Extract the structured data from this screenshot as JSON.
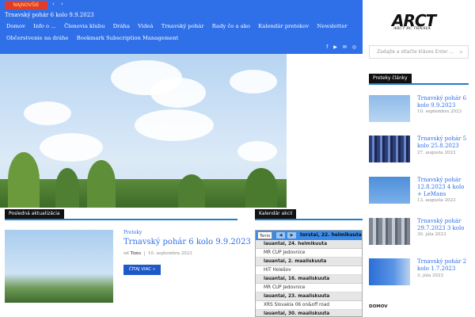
{
  "ticker": {
    "badge": "NAJNOVŠIE",
    "prev_icon": "‹",
    "next_icon": "›",
    "text": "Trnavský pohár 6 kolo 9.9.2023"
  },
  "nav": {
    "items": [
      "Domov",
      "Info o ...",
      "Členovia klubu",
      "Dráha",
      "Videá",
      "Trnavský pohár",
      "Rady čo a ako",
      "Kalendár pretekov",
      "Newsletter",
      "Občerstvenie na dráhe",
      "Bookmark Subscription Management"
    ]
  },
  "social": {
    "icons": [
      "f",
      "▶",
      "✉",
      "◎"
    ]
  },
  "sections": {
    "latest": "Posledná aktualizácia",
    "calendar": "Kalendár akcií"
  },
  "post": {
    "category": "Preteky",
    "title": "Trnavský pohár 6 kolo 9.9.2023",
    "by": "od",
    "author": "Tono",
    "separator": "|",
    "date": "10. septembra 2023",
    "read_more": "ČÍTAJ VIAC »"
  },
  "calendar": {
    "tab": "Tento&nbsp;",
    "tab_label": "Tento",
    "prev": "◀",
    "next": "▶",
    "current": "torstai, 22. helmikuuta",
    "days": [
      {
        "day": "lauantai, 24. helmikuuta",
        "event": "MR CUP Jedovnice"
      },
      {
        "day": "lauantai, 2. maaliskuuta",
        "event": "HIT Holešov"
      },
      {
        "day": "lauantai, 16. maaliskuuta",
        "event": "MR CUP Jedovnice"
      },
      {
        "day": "lauantai, 23. maaliskuuta",
        "event": "XRS Slovakia 06 on&off road"
      },
      {
        "day": "lauantai, 30. maaliskuuta",
        "event": ""
      }
    ]
  },
  "sidebar": {
    "logo": "ARCT",
    "logo_sub": "ARCT RC TRNAVA",
    "search_placeholder": "Zadajte a stlačte kláves Enter ...",
    "search_icon": "search-icon",
    "section": "Preteky články",
    "articles": [
      {
        "title": "Trnavský pohár 6 kolo 9.9.2023",
        "date": "10. septembra 2023"
      },
      {
        "title": "Trnavský pohár 5 kolo 25.8.2023",
        "date": "27. augusta 2023"
      },
      {
        "title": "Trnavský pohár 12.8.2023 4 kolo + LeMans",
        "date": "13. augusta 2023"
      },
      {
        "title": "Trnavský pohár 29.7.2023 3 kolo",
        "date": "30. júla 2023"
      },
      {
        "title": "Trnavský pohár 2 kolo 1.7.2023",
        "date": "3. júla 2023"
      }
    ],
    "footer": "DOMOV"
  }
}
